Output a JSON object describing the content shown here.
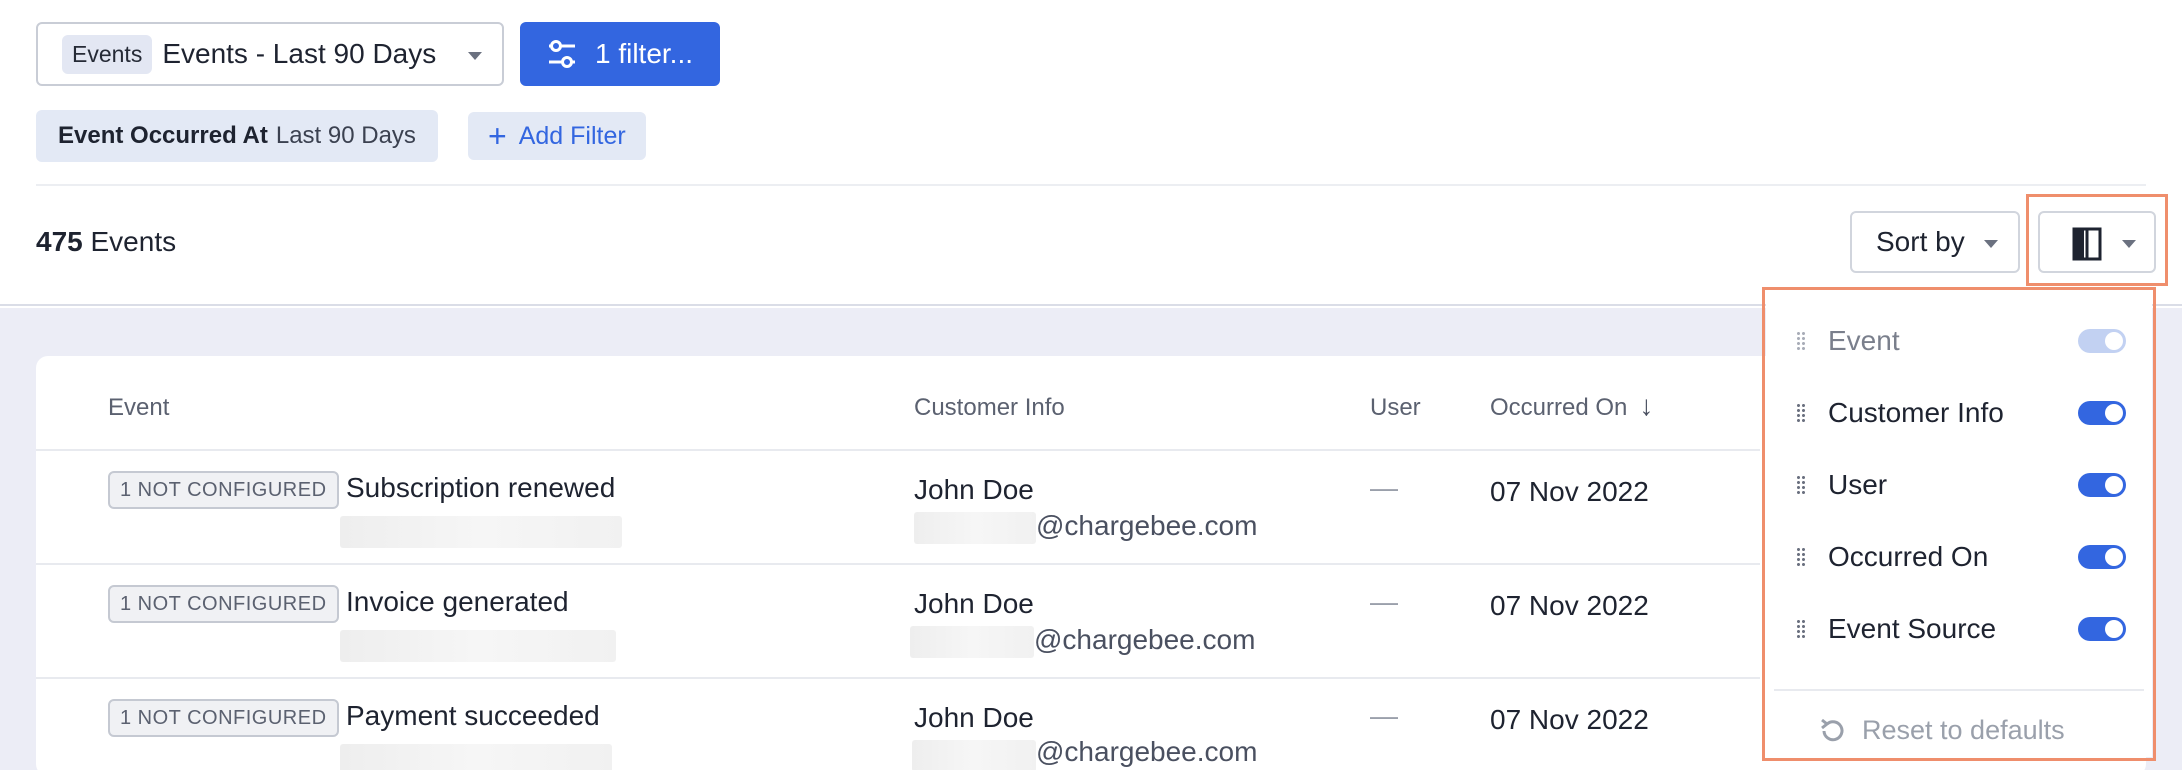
{
  "view": {
    "tag": "Events",
    "name": "Events - Last 90 Days"
  },
  "filter_button": {
    "label": "1 filter..."
  },
  "active_filter": {
    "field": "Event Occurred At",
    "value": "Last 90 Days"
  },
  "add_filter": {
    "label": "Add Filter"
  },
  "summary": {
    "count": "475",
    "unit": "Events"
  },
  "sort": {
    "label": "Sort by"
  },
  "table": {
    "headers": {
      "event": "Event",
      "customer": "Customer Info",
      "user": "User",
      "occurred": "Occurred On",
      "sort_arrow": "↓"
    },
    "rows": [
      {
        "badge": "1 NOT CONFIGURED",
        "event": "Subscription renewed",
        "customer": "John Doe",
        "email": "@chargebee.com",
        "user": "—",
        "date": "07 Nov 2022"
      },
      {
        "badge": "1 NOT CONFIGURED",
        "event": "Invoice generated",
        "customer": "John Doe",
        "email": "@chargebee.com",
        "user": "—",
        "date": "07 Nov 2022"
      },
      {
        "badge": "1 NOT CONFIGURED",
        "event": "Payment succeeded",
        "customer": "John Doe",
        "email": "@chargebee.com",
        "user": "—",
        "date": "07 Nov 2022"
      }
    ]
  },
  "columns_menu": {
    "options": [
      {
        "label": "Event",
        "enabled": true,
        "locked": true
      },
      {
        "label": "Customer Info",
        "enabled": true,
        "locked": false
      },
      {
        "label": "User",
        "enabled": true,
        "locked": false
      },
      {
        "label": "Occurred On",
        "enabled": true,
        "locked": false
      },
      {
        "label": "Event Source",
        "enabled": true,
        "locked": false
      }
    ],
    "reset_label": "Reset to defaults"
  },
  "colors": {
    "primary": "#3366e0",
    "highlight": "#ef8e6c",
    "background": "#ecedf6"
  },
  "icons": {
    "filter": "sliders-icon",
    "columns": "columns-icon",
    "reset": "reset-icon",
    "drag": "drag-handle-icon"
  }
}
